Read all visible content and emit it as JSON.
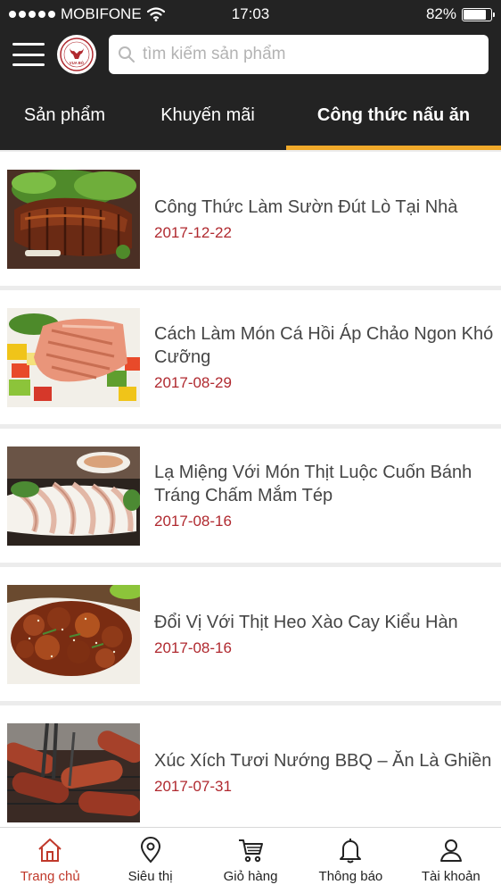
{
  "status_bar": {
    "carrier": "MOBIFONE",
    "time": "17:03",
    "battery": "82%",
    "battery_level": 0.82
  },
  "header": {
    "search_placeholder": "tìm kiếm sản phẩm",
    "logo_text": "VUA BÒ"
  },
  "tabs": [
    {
      "label": "Sản phẩm",
      "active": false
    },
    {
      "label": "Khuyến mãi",
      "active": false
    },
    {
      "label": "Công thức nấu ăn",
      "active": true
    }
  ],
  "recipes": [
    {
      "title": "Công Thức Làm Sườn Đút Lò Tại Nhà",
      "date": "2017-12-22"
    },
    {
      "title": "Cách Làm Món Cá Hồi Áp Chảo Ngon Khó Cưỡng",
      "date": "2017-08-29"
    },
    {
      "title": "Lạ Miệng Với Món Thịt Luộc Cuốn Bánh Tráng Chấm Mắm Tép",
      "date": "2017-08-16"
    },
    {
      "title": "Đổi Vị Với Thịt Heo Xào Cay Kiểu Hàn",
      "date": "2017-08-16"
    },
    {
      "title": "Xúc Xích Tươi Nướng BBQ – Ăn Là Ghiền",
      "date": "2017-07-31"
    }
  ],
  "bottom_nav": [
    {
      "label": "Trang chủ",
      "icon": "home-icon",
      "active": true
    },
    {
      "label": "Siêu thị",
      "icon": "location-pin-icon",
      "active": false
    },
    {
      "label": "Giỏ hàng",
      "icon": "cart-icon",
      "active": false
    },
    {
      "label": "Thông báo",
      "icon": "bell-icon",
      "active": false
    },
    {
      "label": "Tài khoản",
      "icon": "user-icon",
      "active": false
    }
  ],
  "colors": {
    "header_bg": "#232323",
    "tab_indicator": "#f0a92a",
    "date_text": "#b0292f",
    "active_nav": "#c0392b"
  }
}
